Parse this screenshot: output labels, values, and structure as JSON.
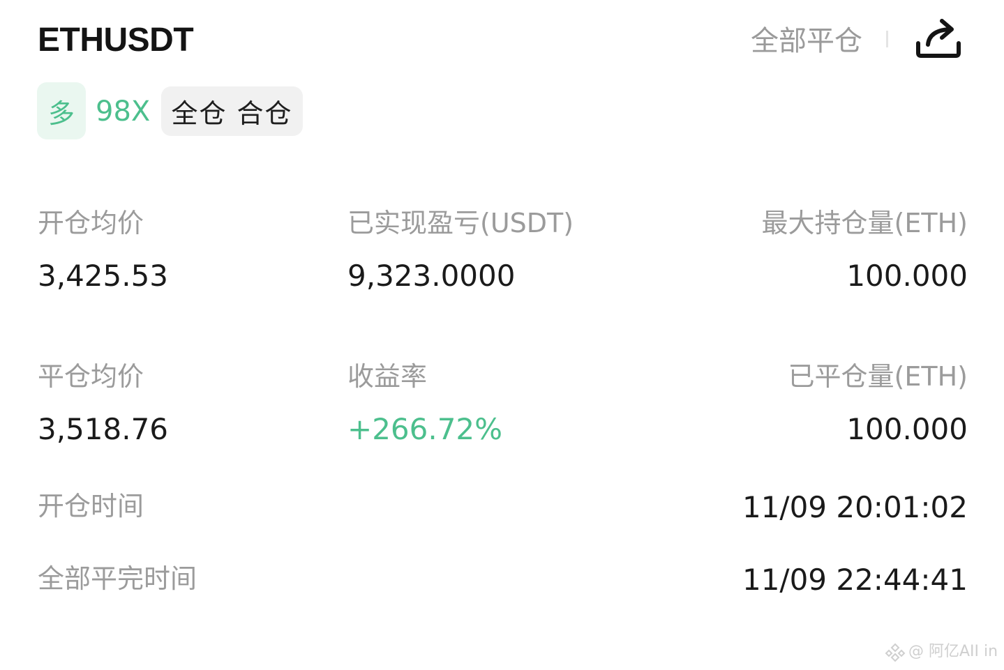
{
  "header": {
    "symbol": "ETHUSDT",
    "close_all_label": "全部平仓",
    "share_icon": "share-icon"
  },
  "tags": {
    "direction": "多",
    "leverage": "98X",
    "margin_mode": "全仓 合仓"
  },
  "stats": {
    "open_avg_price": {
      "label": "开仓均价",
      "value": "3,425.53"
    },
    "realized_pnl": {
      "label": "已实现盈亏(USDT)",
      "value": "9,323.0000"
    },
    "max_position": {
      "label": "最大持仓量(ETH)",
      "value": "100.000"
    },
    "close_avg_price": {
      "label": "平仓均价",
      "value": "3,518.76"
    },
    "return_rate": {
      "label": "收益率",
      "value": "+266.72%"
    },
    "closed_amount": {
      "label": "已平仓量(ETH)",
      "value": "100.000"
    }
  },
  "times": {
    "open_time": {
      "label": "开仓时间",
      "value": "11/09 20:01:02"
    },
    "close_all_time": {
      "label": "全部平完时间",
      "value": "11/09 22:44:41"
    }
  },
  "watermark": {
    "text": "@ 阿亿AII in",
    "icon": "binance-square-icon"
  },
  "colors": {
    "accent_green": "#4cbf8d",
    "tag_green_bg": "#eaf7f0",
    "label_gray": "#9b9b9b",
    "text_dark": "#1a1a1a"
  }
}
